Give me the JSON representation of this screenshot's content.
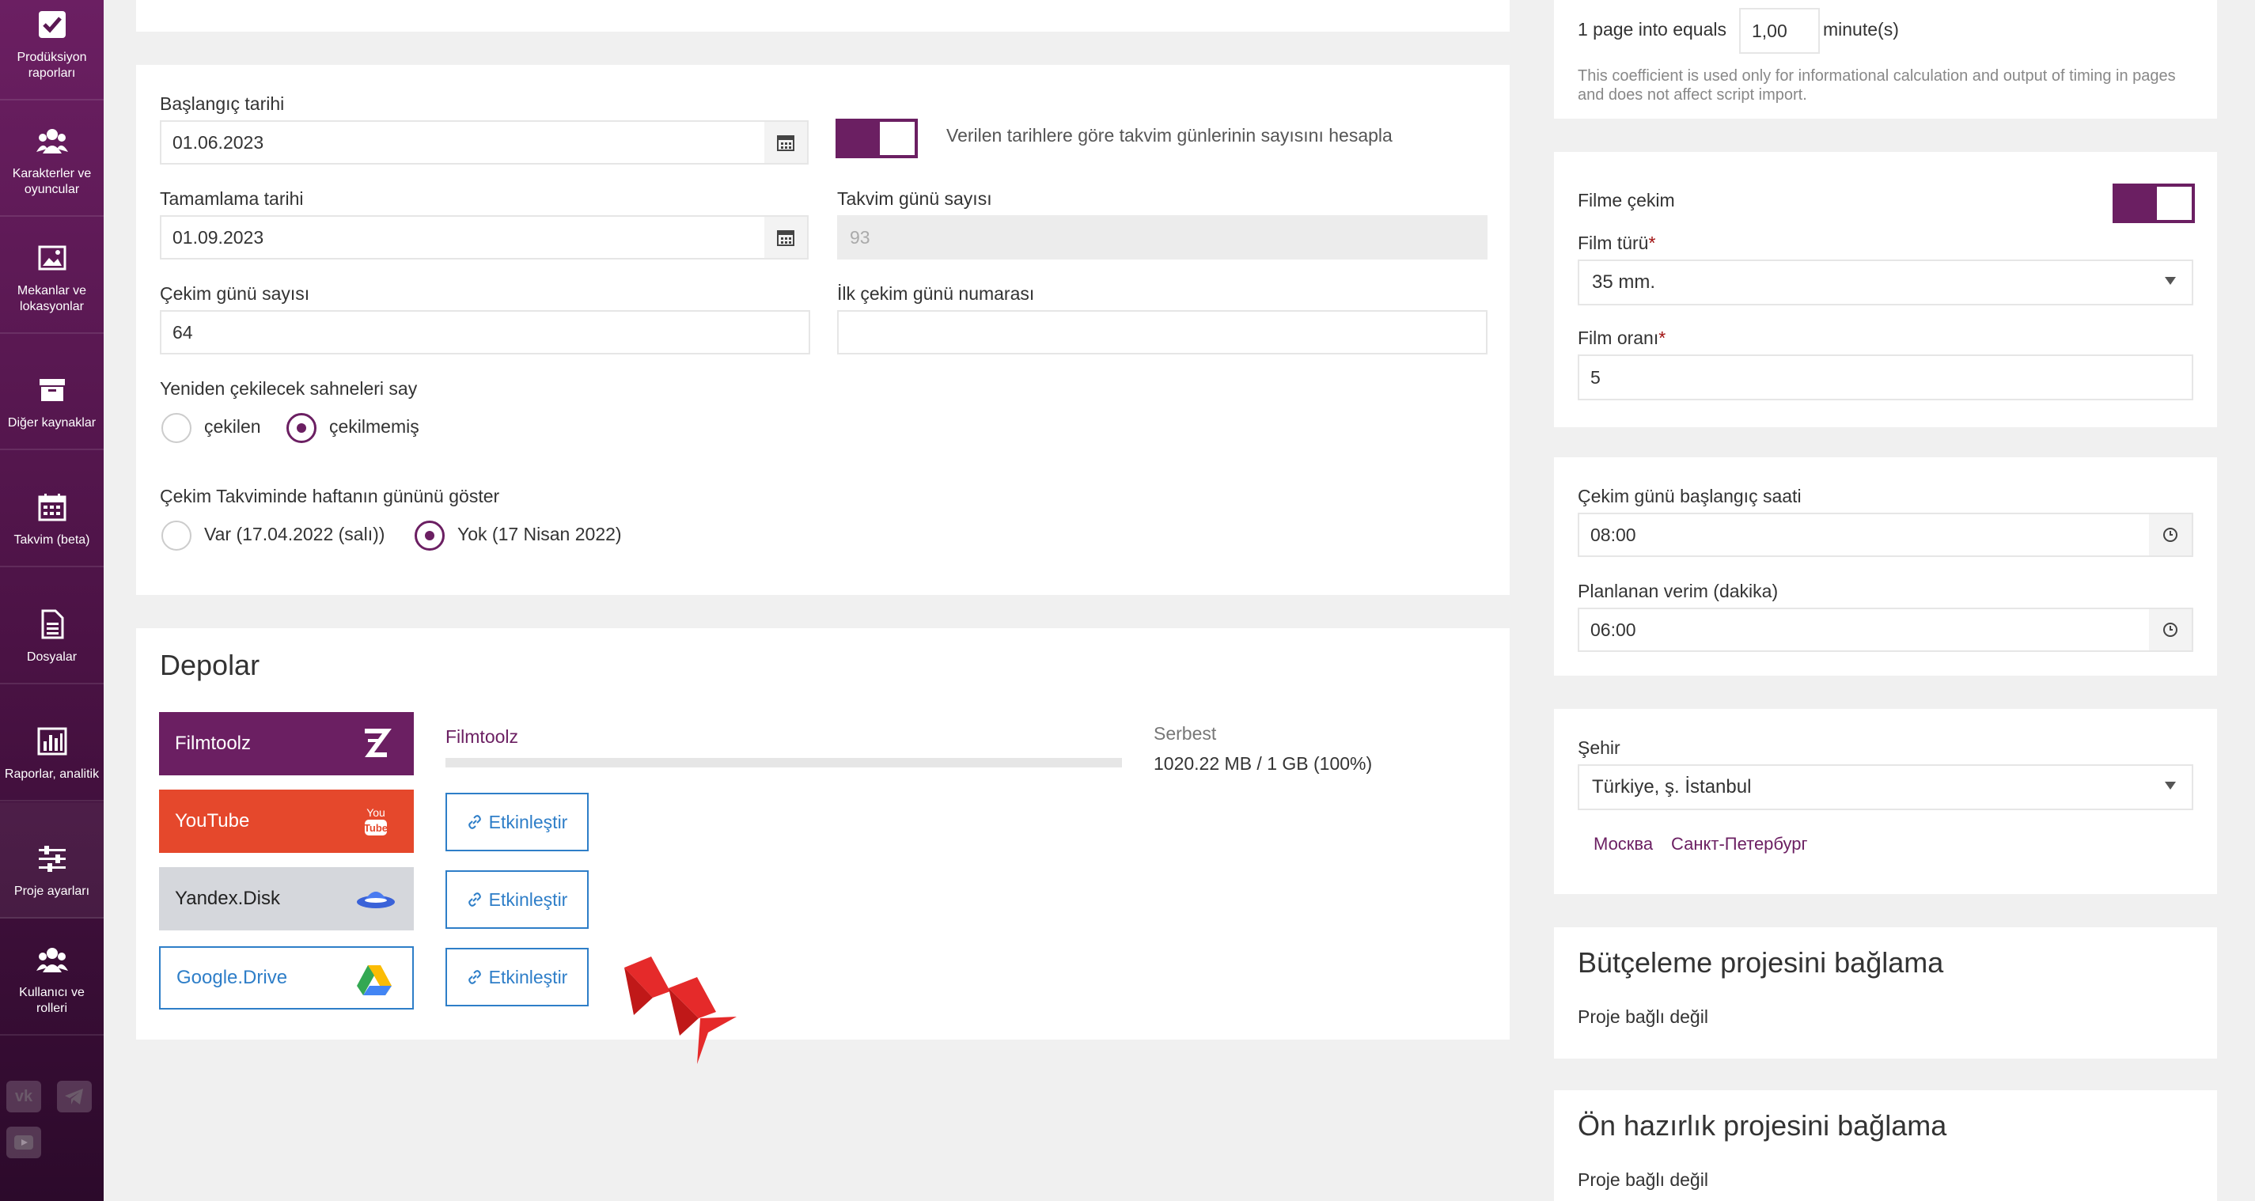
{
  "sidebar": {
    "items": [
      {
        "label": "Prodüksiyon raporları",
        "icon": "checkbox-icon"
      },
      {
        "label": "Karakterler ve oyuncular",
        "icon": "users-icon"
      },
      {
        "label": "Mekanlar ve lokasyonlar",
        "icon": "image-icon"
      },
      {
        "label": "Diğer kaynaklar",
        "icon": "archive-icon"
      },
      {
        "label": "Takvim (beta)",
        "icon": "calendar-icon"
      },
      {
        "label": "Dosyalar",
        "icon": "file-icon"
      },
      {
        "label": "Raporlar, analitik",
        "icon": "bar-chart-icon"
      },
      {
        "label": "Proje ayarları",
        "icon": "sliders-icon"
      },
      {
        "label": "Kullanıcı ve rolleri",
        "icon": "users-icon"
      }
    ],
    "social": [
      "vk-icon",
      "telegram-icon",
      "youtube-icon"
    ]
  },
  "dates": {
    "start_label": "Başlangıç tarihi",
    "start_value": "01.06.2023",
    "end_label": "Tamamlama tarihi",
    "end_value": "01.09.2023",
    "calc_toggle_label": "Verilen tarihlere göre takvim günlerinin sayısını hesapla",
    "calendar_days_label": "Takvim günü sayısı",
    "calendar_days_value": "93",
    "shoot_days_label": "Çekim günü sayısı",
    "shoot_days_value": "64",
    "first_day_label": "İlk çekim günü numarası",
    "first_day_value": "",
    "reshoot_label": "Yeniden çekilecek sahneleri say",
    "reshoot_opt1": "çekilen",
    "reshoot_opt2": "çekilmemiş",
    "weekday_label": "Çekim Takviminde haftanın gününü göster",
    "weekday_opt1": "Var (17.04.2022 (salı))",
    "weekday_opt2": "Yok (17 Nisan 2022)"
  },
  "storage": {
    "title": "Depolar",
    "items": [
      {
        "name": "Filmtoolz",
        "color": "#6b1f62"
      },
      {
        "name": "YouTube",
        "color": "#e5482c"
      },
      {
        "name": "Yandex.Disk",
        "color": "#d5d7dc"
      },
      {
        "name": "Google.Drive",
        "color": "#ffffff"
      }
    ],
    "active_name": "Filmtoolz",
    "free_label": "Serbest",
    "free_value": "1020.22 MB / 1 GB (100%)",
    "usage_fraction": 0.0,
    "enable_label": "Etkinleştir"
  },
  "timing": {
    "page_prefix": "1 page into equals",
    "page_value": "1,00",
    "page_suffix": "minute(s)",
    "note": "This coefficient is used only for informational calculation and output of timing in pages and does not affect script import."
  },
  "film": {
    "label": "Filme çekim",
    "type_label": "Film türü",
    "type_value": "35 mm.",
    "ratio_label": "Film oranı",
    "ratio_value": "5",
    "required_mark": "*"
  },
  "shooting": {
    "start_time_label": "Çekim günü başlangıç saati",
    "start_time_value": "08:00",
    "planned_label": "Planlanan verim (dakika)",
    "planned_value": "06:00"
  },
  "city": {
    "label": "Şehir",
    "value": "Türkiye, ş. İstanbul",
    "quick1": "Москва",
    "quick2": "Санкт-Петербург"
  },
  "budget": {
    "title": "Bütçeleme projesini bağlama",
    "status": "Proje bağlı değil"
  },
  "prep": {
    "title": "Ön hazırlık projesini bağlama",
    "status": "Proje bağlı değil"
  }
}
